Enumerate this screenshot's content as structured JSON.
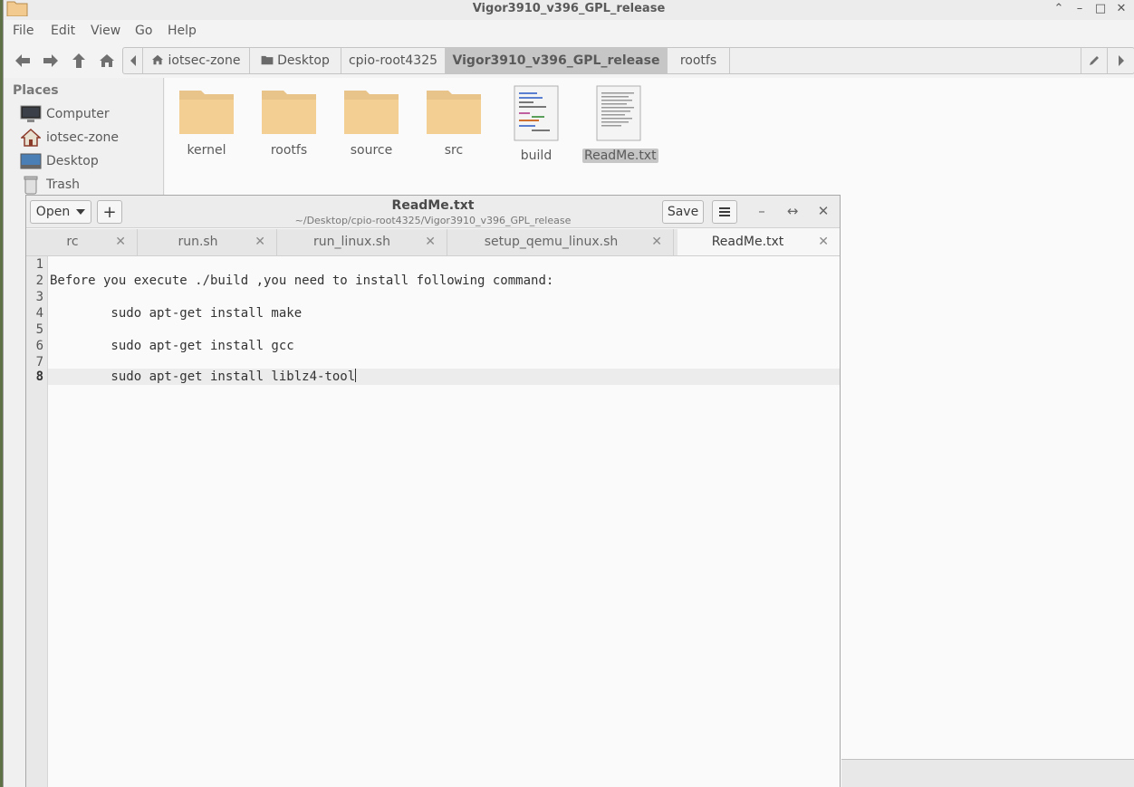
{
  "file_manager": {
    "title": "Vigor3910_v396_GPL_release",
    "menu": [
      "File",
      "Edit",
      "View",
      "Go",
      "Help"
    ],
    "breadcrumbs": [
      "iotsec-zone",
      "Desktop",
      "cpio-root4325",
      "Vigor3910_v396_GPL_release",
      "rootfs"
    ],
    "active_crumb": "Vigor3910_v396_GPL_release",
    "sidebar": {
      "heading": "Places",
      "items": [
        {
          "label": "Computer",
          "icon": "computer-icon"
        },
        {
          "label": "iotsec-zone",
          "icon": "home-icon"
        },
        {
          "label": "Desktop",
          "icon": "desktop-icon"
        },
        {
          "label": "Trash",
          "icon": "trash-icon"
        }
      ]
    },
    "files": [
      {
        "name": "kernel",
        "type": "folder"
      },
      {
        "name": "rootfs",
        "type": "folder"
      },
      {
        "name": "source",
        "type": "folder"
      },
      {
        "name": "src",
        "type": "folder"
      },
      {
        "name": "build",
        "type": "script"
      },
      {
        "name": "ReadMe.txt",
        "type": "text",
        "selected": true
      }
    ]
  },
  "editor": {
    "open_label": "Open",
    "new_tab_label": "+",
    "title": "ReadMe.txt",
    "subtitle": "~/Desktop/cpio-root4325/Vigor3910_v396_GPL_release",
    "save_label": "Save",
    "tabs": [
      {
        "label": "rc",
        "active": false
      },
      {
        "label": "run.sh",
        "active": false
      },
      {
        "label": "run_linux.sh",
        "active": false
      },
      {
        "label": "setup_qemu_linux.sh",
        "active": false
      },
      {
        "label": "ReadMe.txt",
        "active": true
      }
    ],
    "current_line": 8,
    "lines": [
      "",
      "Before you execute ./build ,you need to install following command:",
      "",
      "        sudo apt-get install make",
      "",
      "        sudo apt-get install gcc",
      "",
      "        sudo apt-get install liblz4-tool"
    ],
    "line_numbers": [
      "1",
      "2",
      "3",
      "4",
      "5",
      "6",
      "7",
      "8"
    ]
  }
}
